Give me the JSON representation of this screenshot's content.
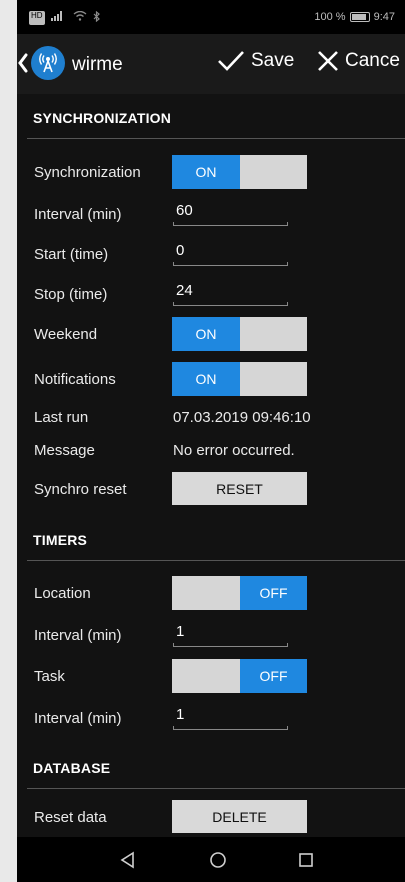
{
  "status_bar": {
    "carrier": "HD",
    "battery": "100 %",
    "time": "9:47"
  },
  "toolbar": {
    "app_name": "wirme",
    "save_label": "Save",
    "cancel_label": "Cance"
  },
  "sections": {
    "synchronization": {
      "title": "SYNCHRONIZATION",
      "synchronization_label": "Synchronization",
      "synchronization_state": "ON",
      "interval_label": "Interval (min)",
      "interval_value": "60",
      "start_label": "Start (time)",
      "start_value": "0",
      "stop_label": "Stop (time)",
      "stop_value": "24",
      "weekend_label": "Weekend",
      "weekend_state": "ON",
      "notifications_label": "Notifications",
      "notifications_state": "ON",
      "last_run_label": "Last run",
      "last_run_value": "07.03.2019 09:46:10",
      "message_label": "Message",
      "message_value": "No error occurred.",
      "reset_label": "Synchro reset",
      "reset_button": "RESET"
    },
    "timers": {
      "title": "TIMERS",
      "location_label": "Location",
      "location_state": "OFF",
      "location_interval_label": "Interval (min)",
      "location_interval_value": "1",
      "task_label": "Task",
      "task_state": "OFF",
      "task_interval_label": "Interval (min)",
      "task_interval_value": "1"
    },
    "database": {
      "title": "DATABASE",
      "reset_data_label": "Reset data",
      "delete_button": "DELETE"
    }
  },
  "icons": {
    "back": "chevron-left-icon",
    "app": "antenna-icon",
    "save": "check-icon",
    "cancel": "close-icon",
    "nav_back": "triangle-back-icon",
    "nav_home": "circle-home-icon",
    "nav_recent": "square-recent-icon"
  },
  "colors": {
    "accent": "#1f88e0",
    "background": "#121212",
    "toggle_off": "#d6d6d6"
  }
}
